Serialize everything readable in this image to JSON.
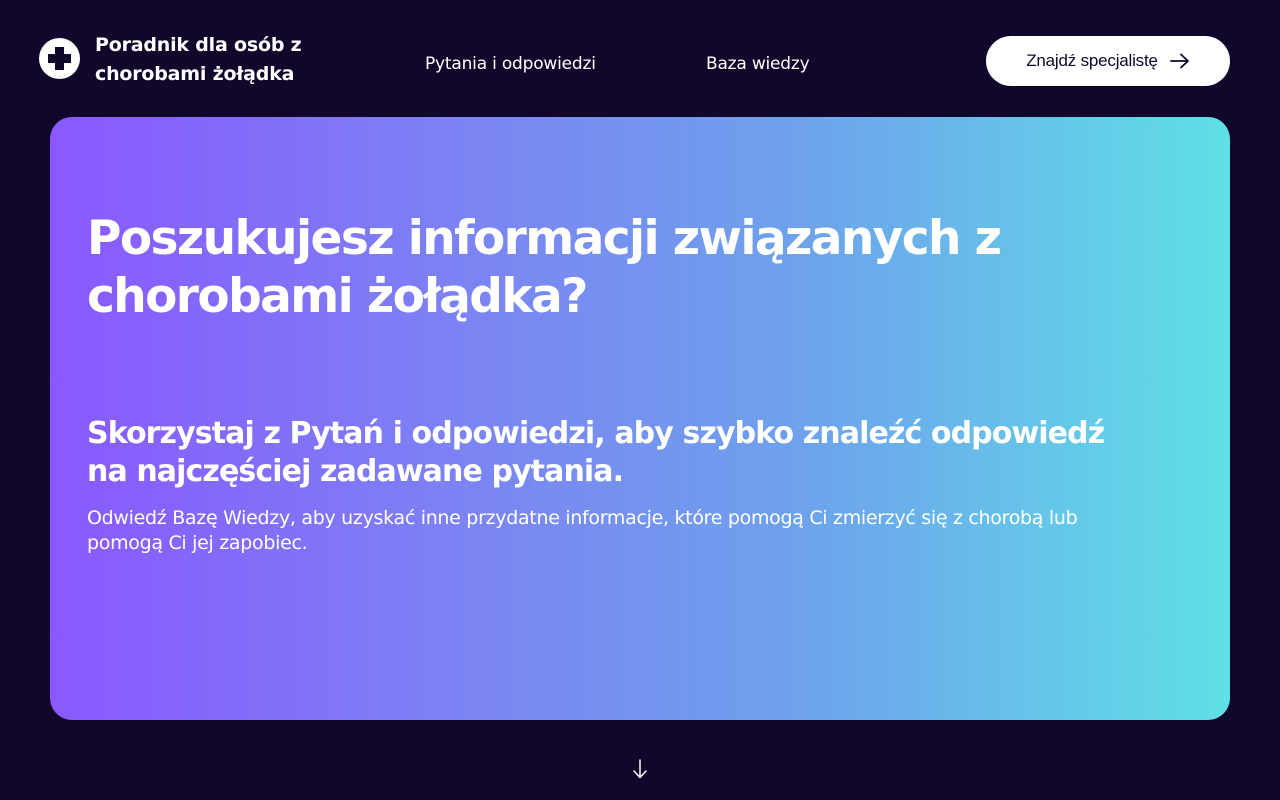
{
  "header": {
    "brand": "Poradnik dla osób z chorobami żołądka",
    "nav": [
      {
        "label": "Pytania i odpowiedzi"
      },
      {
        "label": "Baza wiedzy"
      }
    ],
    "cta_label": "Znajdź specjalistę"
  },
  "hero": {
    "title": "Poszukujesz informacji związanych z chorobami żołądka?",
    "subtitle": "Skorzystaj z Pytań i odpowiedzi, aby szybko znaleźć odpowiedź na najczęściej zadawane pytania.",
    "text": "Odwiedź Bazę Wiedzy, aby  uzyskać inne przydatne informacje, które pomogą Ci zmierzyć się z chorobą lub pomogą Ci jej zapobiec."
  },
  "icons": {
    "logo": "medical-cross-icon",
    "cta": "arrow-right-icon",
    "scroll": "arrow-down-icon"
  },
  "colors": {
    "background": "#11072b",
    "gradient_start": "#8a58ff",
    "gradient_end": "#5fe0e6",
    "text": "#ffffff"
  }
}
